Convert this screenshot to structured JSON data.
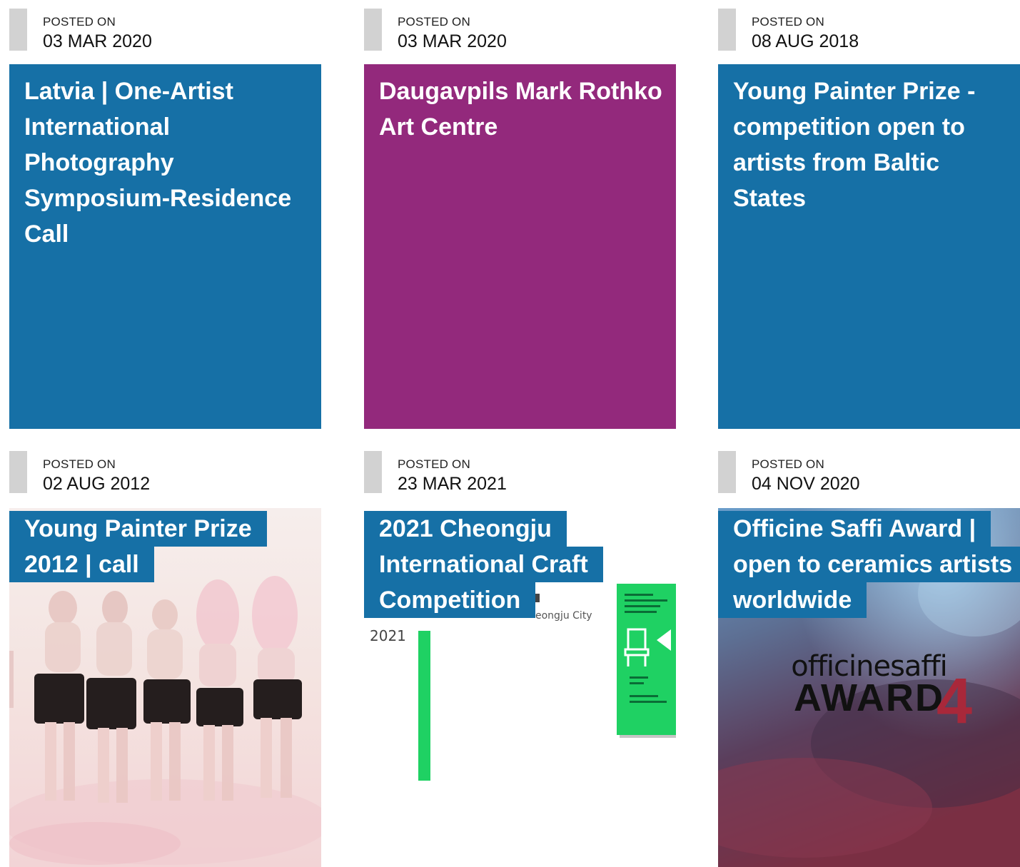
{
  "colors": {
    "blue": "#1670a6",
    "purple": "#93297c",
    "date_bar": "#d2d2d2"
  },
  "posts": [
    {
      "posted_label": "POSTED ON",
      "date": "03 MAR 2020",
      "title": "Latvia | One-Artist International Photography Symposium-Residence Call",
      "card_style": "solid-blue"
    },
    {
      "posted_label": "POSTED ON",
      "date": "03 MAR 2020",
      "title": "Daugavpils Mark Rothko Art Centre",
      "card_style": "solid-purple"
    },
    {
      "posted_label": "POSTED ON",
      "date": "08 AUG 2018",
      "title": "Young Painter Prize - competition open to artists from Baltic States",
      "card_style": "solid-blue"
    },
    {
      "posted_label": "POSTED ON",
      "date": "02 AUG 2012",
      "title_lines": [
        "Young Painter Prize",
        "2012 | call"
      ],
      "card_style": "image",
      "image": "painting of men in black shorts"
    },
    {
      "posted_label": "POSTED ON",
      "date": "23 MAR 2021",
      "title_lines": [
        "2021 Cheongju",
        "International Craft",
        "Competition"
      ],
      "card_style": "image",
      "image": "craft biennale poster",
      "image_text": [
        "eongju City",
        "2021"
      ]
    },
    {
      "posted_label": "POSTED ON",
      "date": "04 NOV 2020",
      "title_lines": [
        "Officine Saffi Award |",
        "open to ceramics artists",
        "worldwide"
      ],
      "card_style": "image",
      "image": "officinesaffi award 4 poster",
      "image_text": [
        "officinesaffi",
        "AWARD",
        "4"
      ]
    }
  ]
}
